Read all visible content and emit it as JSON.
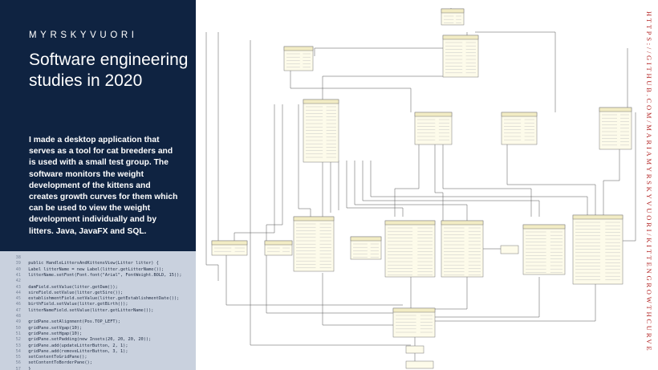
{
  "brand": "MYRSKYVUORI",
  "title": "Software engineering studies in 2020",
  "description": "I made a desktop application that serves as a tool for cat breeders and is used with a small test group. The software monitors the weight development of the kittens and creates growth curves for them which can be used to view the weight development individually and by litters. Java, JavaFX and SQL.",
  "side_url": "HTTPS://GITHUB.COM/MARIAMYRSKYVUORI/KITTENGROWTHCURVE",
  "colors": {
    "panel": "#0f2341",
    "code_bg": "#c9d1de",
    "accent_red": "#b32525",
    "uml_header": "#f2ecc4",
    "uml_body": "#fdfbea"
  },
  "code_lines": [
    {
      "num": "38",
      "text": ""
    },
    {
      "num": "39",
      "text": "    public HandleLittersAndKittensView(Litter litter) {"
    },
    {
      "num": "40",
      "text": "        Label litterName = new Label(litter.getLitterName());"
    },
    {
      "num": "41",
      "text": "        litterName.setFont(Font.font(\"Arial\", FontWeight.BOLD, 15));"
    },
    {
      "num": "42",
      "text": ""
    },
    {
      "num": "43",
      "text": "        damField.setValue(litter.getDam());"
    },
    {
      "num": "44",
      "text": "        sireField.setValue(litter.getSire());"
    },
    {
      "num": "45",
      "text": "        establishmentField.setValue(litter.getEstablishmentDate());"
    },
    {
      "num": "46",
      "text": "        birthField.setValue(litter.getBirth());"
    },
    {
      "num": "47",
      "text": "        litterNameField.setValue(litter.getLitterName());"
    },
    {
      "num": "48",
      "text": ""
    },
    {
      "num": "49",
      "text": "        gridPane.setAlignment(Pos.TOP_LEFT);"
    },
    {
      "num": "50",
      "text": "        gridPane.setVgap(10);"
    },
    {
      "num": "51",
      "text": "        gridPane.setHgap(10);"
    },
    {
      "num": "52",
      "text": "        gridPane.setPadding(new Insets(20, 20, 20, 20));"
    },
    {
      "num": "53",
      "text": "        gridPane.add(updateLitterButton, 2, 1);"
    },
    {
      "num": "54",
      "text": "        gridPane.add(removeLitterButton, 3, 1);"
    },
    {
      "num": "55",
      "text": "        setContentToGridPane();"
    },
    {
      "num": "56",
      "text": "        setContentToBorderPane();"
    },
    {
      "num": "57",
      "text": "    }"
    }
  ],
  "uml_classes": [
    "Weight",
    "Kitten",
    "Litter",
    "Breeder",
    "Queen",
    "TomCat",
    "Database",
    "KittenService",
    "HandleLittersAndKittensView",
    "AddLitterView",
    "WeightView",
    "CalendarView",
    "Launcher",
    "App"
  ]
}
